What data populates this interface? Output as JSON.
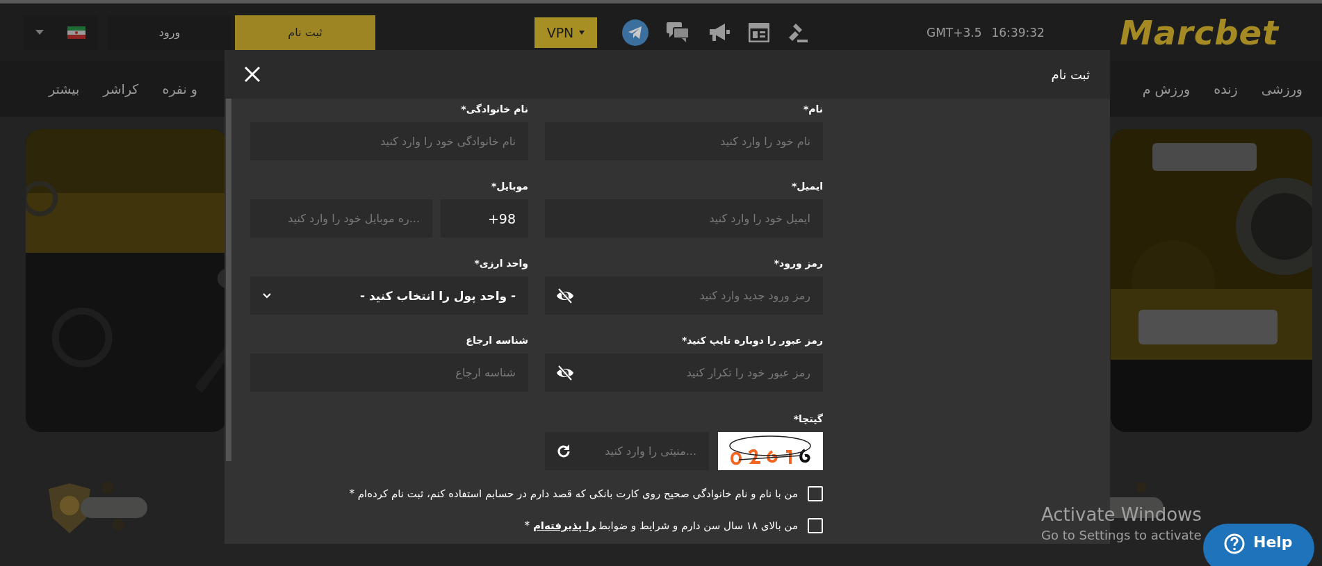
{
  "header": {
    "logo": "Marcbet",
    "time_zone": "GMT+3.5",
    "time": "16:39:32",
    "vpn": "VPN",
    "register": "ثبت نام",
    "login": "ورود"
  },
  "nav": {
    "right": [
      "ورزشی",
      "زنده",
      "ورزش م"
    ],
    "left": [
      "و نفره",
      "کراشر",
      "بیشتر"
    ]
  },
  "modal": {
    "title": "ثبت نام",
    "fields": [
      {
        "label": "نام*",
        "kind": "text",
        "placeholder": "نام خود را وارد کنید"
      },
      {
        "label": "نام خانوادگی*",
        "kind": "text",
        "placeholder": "نام خانوادگی خود را وارد کنید"
      },
      {
        "label": "ایمیل*",
        "kind": "text",
        "placeholder": "ایمیل خود را وارد کنید"
      },
      {
        "label": "موبایل*",
        "kind": "phone",
        "code": "+98",
        "placeholder": "...ره موبایل خود را وارد کنید"
      },
      {
        "label": "رمز ورود*",
        "kind": "password",
        "placeholder": "رمز ورود جدید وارد کنید"
      },
      {
        "label": "واحد ارزی*",
        "kind": "select",
        "value": "- واحد پول را انتخاب کنید -"
      },
      {
        "label": "رمز عبور را دوباره تایپ کنید*",
        "kind": "password",
        "placeholder": "رمز عبور خود را تکرار کنید"
      },
      {
        "label": "شناسه ارجاع",
        "kind": "text",
        "placeholder": "شناسه ارجاع"
      }
    ],
    "captcha": {
      "label": "گپتچا*",
      "placeholder": "...منیتی را وارد کنید"
    },
    "agreements": [
      {
        "text": "من با نام و نام خانوادگی صحیح روی کارت بانکی که قصد دارم در حسابم استفاده کنم، ثبت نام کرده‌ام *",
        "checked": false
      },
      {
        "text": "من بالای ۱۸ سال سن دارم و شرایط و ضوابط",
        "link": "را پذیرفته‌ام",
        "suffix": "*",
        "checked": false
      }
    ]
  },
  "os_notice": {
    "title": "Activate Windows",
    "subtitle": "Go to Settings to activate"
  },
  "help": "Help"
}
